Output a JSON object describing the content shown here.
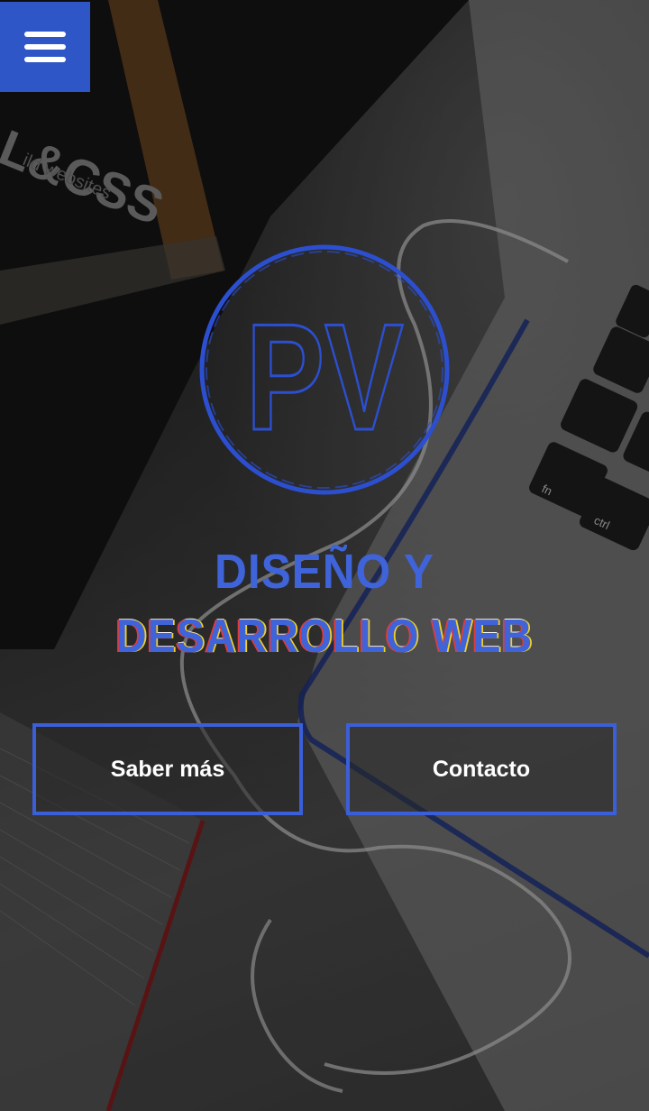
{
  "nav": {
    "menu_icon": "hamburger-menu-icon"
  },
  "logo": {
    "text": "PV"
  },
  "hero": {
    "title_line1": "DISEÑO Y",
    "title_line2": "DESARROLLO WEB"
  },
  "background_photo": {
    "book_text_large": "L&CSS",
    "book_text_small": "ild websites",
    "key_fn": "fn",
    "key_ctrl": "ctrl"
  },
  "actions": {
    "saber_mas_label": "Saber más",
    "contacto_label": "Contacto"
  },
  "colors": {
    "accent": "#2e56c6",
    "accent_light": "#3f63d8",
    "button_text": "#ffffff",
    "overlay": "#2b2b2b"
  }
}
